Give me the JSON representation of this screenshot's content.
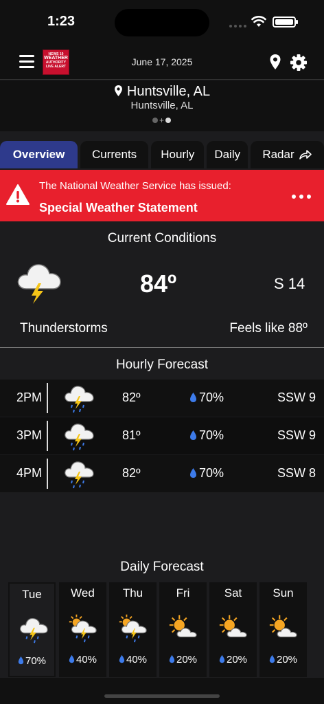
{
  "status": {
    "time": "1:23"
  },
  "header": {
    "date": "June 17, 2025",
    "logo_lines": [
      "NEWS 19",
      "WEATHER",
      "AUTHORITY",
      "LIVE ALERT"
    ]
  },
  "location": {
    "name": "Huntsville, AL",
    "sub": "Huntsville, AL"
  },
  "tabs": [
    {
      "label": "Overview",
      "active": true
    },
    {
      "label": "Currents"
    },
    {
      "label": "Hourly"
    },
    {
      "label": "Daily"
    },
    {
      "label": "Radar"
    }
  ],
  "alert": {
    "line1": "The National Weather Service has issued:",
    "line2": "Special Weather Statement",
    "color": "#e8202d"
  },
  "current": {
    "title": "Current Conditions",
    "temp": "84º",
    "wind": "S 14",
    "condition": "Thunderstorms",
    "feels_like": "Feels like 88º",
    "icon": "thunderstorm-icon"
  },
  "hourly": {
    "title": "Hourly Forecast",
    "rows": [
      {
        "time": "2PM",
        "temp": "82º",
        "precip": "70%",
        "wind": "SSW 9",
        "icon": "thunder-rain-icon"
      },
      {
        "time": "3PM",
        "temp": "81º",
        "precip": "70%",
        "wind": "SSW 9",
        "icon": "thunder-rain-icon"
      },
      {
        "time": "4PM",
        "temp": "82º",
        "precip": "70%",
        "wind": "SSW 8",
        "icon": "thunder-rain-icon"
      }
    ]
  },
  "daily": {
    "title": "Daily Forecast",
    "days": [
      {
        "day": "Tue",
        "precip": "70%",
        "icon": "thunderstorm-icon"
      },
      {
        "day": "Wed",
        "precip": "40%",
        "icon": "sun-thunder-icon"
      },
      {
        "day": "Thu",
        "precip": "40%",
        "icon": "sun-thunder-icon"
      },
      {
        "day": "Fri",
        "precip": "20%",
        "icon": "partly-sunny-icon"
      },
      {
        "day": "Sat",
        "precip": "20%",
        "icon": "partly-sunny-icon"
      },
      {
        "day": "Sun",
        "precip": "20%",
        "icon": "partly-sunny-icon"
      }
    ]
  },
  "colors": {
    "active_tab": "#2e3a8c",
    "drop": "#3d7bea",
    "bolt": "#f5c518",
    "sun": "#f6a623"
  }
}
